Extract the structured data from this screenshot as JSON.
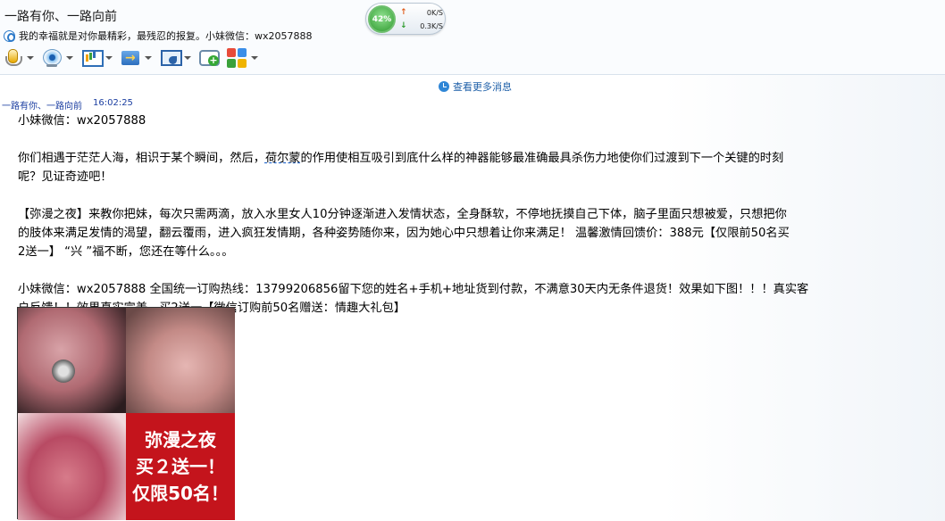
{
  "window": {
    "title": "一路有你、一路向前",
    "signature": "我的幸福就是对你最精彩，最残忍的报复。小妹微信：wx2057888"
  },
  "network": {
    "percent": "42%",
    "upload": "0K/S",
    "download": "0.3K/S"
  },
  "toolbar": {
    "items": [
      "microphone-icon",
      "webcam-icon",
      "screen-share-icon",
      "file-transfer-icon",
      "remote-desktop-icon",
      "add-chat-icon",
      "apps-icon"
    ],
    "apps_colors": [
      "#e84b3a",
      "#3a8ee8",
      "#3aa13a",
      "#f0b400"
    ]
  },
  "history": {
    "view_more": "查看更多消息"
  },
  "message": {
    "sender": "一路有你、一路向前",
    "time": "16:02:25",
    "lines": [
      "小妹微信：wx2057888",
      "",
      "你们相遇于茫茫人海，相识于某个瞬间，然后，",
      "荷尔蒙",
      "的作用使相互吸引到底什么样的神器能够最准确最具杀伤力地使你们过渡到下一个关键的时刻",
      "呢？见证奇迹吧！",
      "",
      "【弥漫之夜】来教你把妹，每次只需两滴，放入水里女人10分钟逐渐进入发情状态，全身酥软，不停地抚摸自己下体，脑子里面只想被爱，只想把你",
      "的肢体来满足发情的渴望，翻云覆雨，进入疯狂发情期，各种姿势随你来，因为她心中只想着让你来满足！    温馨激情回馈价：388元【仅限前50名买",
      "2送一】    “兴 ”福不断，您还在等什么。。。",
      "",
      "小妹微信：wx2057888      全国统一订购热线：13799206856留下您的姓名+手机+地址货到付款，不满意30天内无条件退货！效果如下图！！！真实客",
      "户反馈！！效果真实完美，买2送一【微信订购前50名赠送：情趣大礼包】"
    ]
  },
  "image": {
    "text_line1": "弥漫之夜",
    "text_line2": "买２送一！",
    "text_line3": "仅限50名！"
  }
}
